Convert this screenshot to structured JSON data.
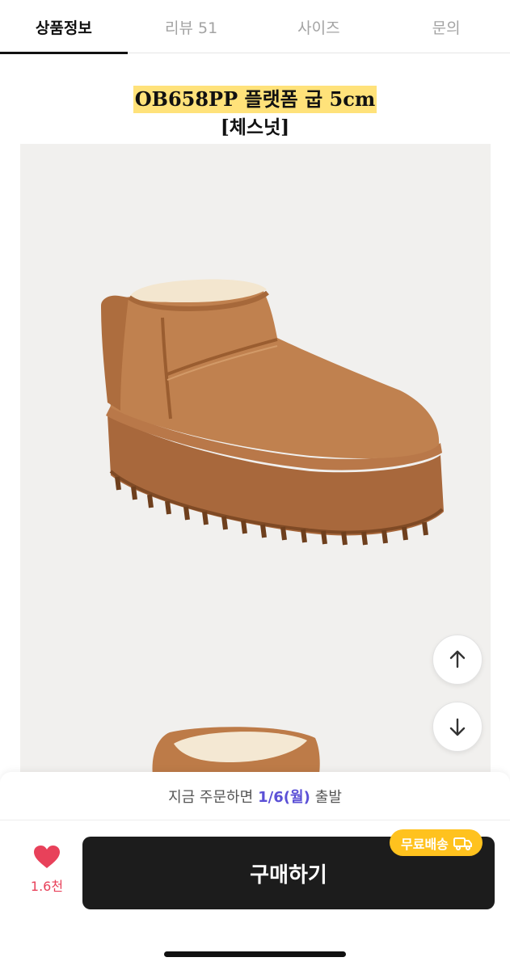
{
  "tabs": [
    {
      "label": "상품정보",
      "active": true
    },
    {
      "label": "리뷰 51",
      "active": false
    },
    {
      "label": "사이즈",
      "active": false
    },
    {
      "label": "문의",
      "active": false
    }
  ],
  "product": {
    "title": "OB658PP 플랫폼 굽 5cm",
    "subtitle": "[체스넛]"
  },
  "delivery": {
    "prefix": "지금 주문하면",
    "date": "1/6(월)",
    "suffix": "출발"
  },
  "like": {
    "count": "1.6천",
    "icon": "heart-icon"
  },
  "buy": {
    "label": "구매하기"
  },
  "badge": {
    "label": "무료배송",
    "icon": "truck-icon"
  },
  "scroll": {
    "up_icon": "arrow-up-icon",
    "down_icon": "arrow-down-icon"
  },
  "colors": {
    "accent": "#5b50d6",
    "heart": "#e8415a",
    "badge": "#ffc21e",
    "button": "#1c1c1c",
    "highlight": "#ffe27a"
  }
}
